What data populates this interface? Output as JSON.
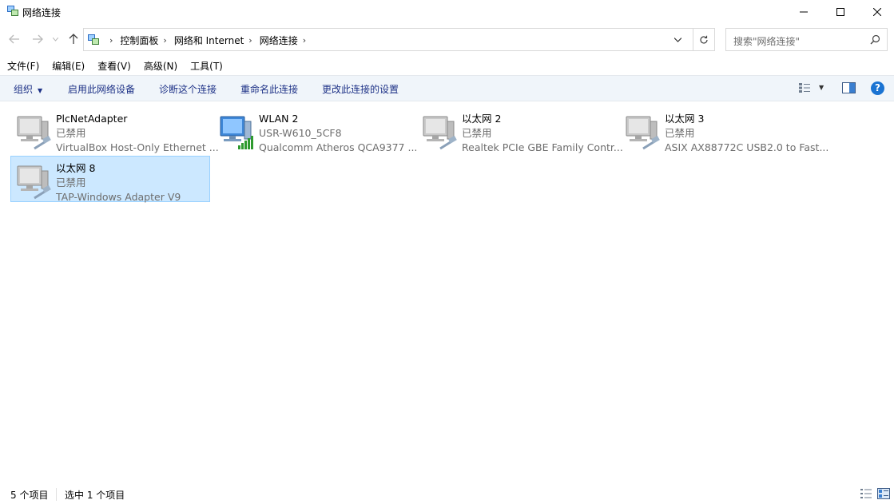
{
  "window": {
    "title": "网络连接",
    "minimize_icon": "minimize-icon",
    "maximize_icon": "maximize-icon",
    "close_icon": "close-icon"
  },
  "address": {
    "breadcrumbs": [
      "控制面板",
      "网络和 Internet",
      "网络连接"
    ],
    "search_placeholder": "搜索\"网络连接\""
  },
  "menu": [
    "文件(F)",
    "编辑(E)",
    "查看(V)",
    "高级(N)",
    "工具(T)"
  ],
  "commands": {
    "organize": "组织",
    "enable": "启用此网络设备",
    "diagnose": "诊断这个连接",
    "rename": "重命名此连接",
    "change": "更改此连接的设置",
    "help": "?"
  },
  "connections": [
    {
      "name": "PlcNetAdapter",
      "status": "已禁用",
      "device": "VirtualBox Host-Only Ethernet ...",
      "type": "wired-disabled",
      "selected": false
    },
    {
      "name": "WLAN 2",
      "status": "USR-W610_5CF8",
      "device": "Qualcomm Atheros QCA9377 ...",
      "type": "wireless",
      "selected": false
    },
    {
      "name": "以太网 2",
      "status": "已禁用",
      "device": "Realtek PCIe GBE Family Contr...",
      "type": "wired-disabled",
      "selected": false
    },
    {
      "name": "以太网 3",
      "status": "已禁用",
      "device": "ASIX AX88772C USB2.0 to Fast...",
      "type": "wired-disabled",
      "selected": false
    },
    {
      "name": "以太网 8",
      "status": "已禁用",
      "device": "TAP-Windows Adapter V9",
      "type": "wired-disabled",
      "selected": true
    }
  ],
  "statusbar": {
    "count": "5 个项目",
    "selected": "选中 1 个项目"
  },
  "colors": {
    "command_text": "#1e3287",
    "selection_bg": "#cce8ff",
    "selection_border": "#99d1ff",
    "help_blue": "#1a73d2"
  }
}
